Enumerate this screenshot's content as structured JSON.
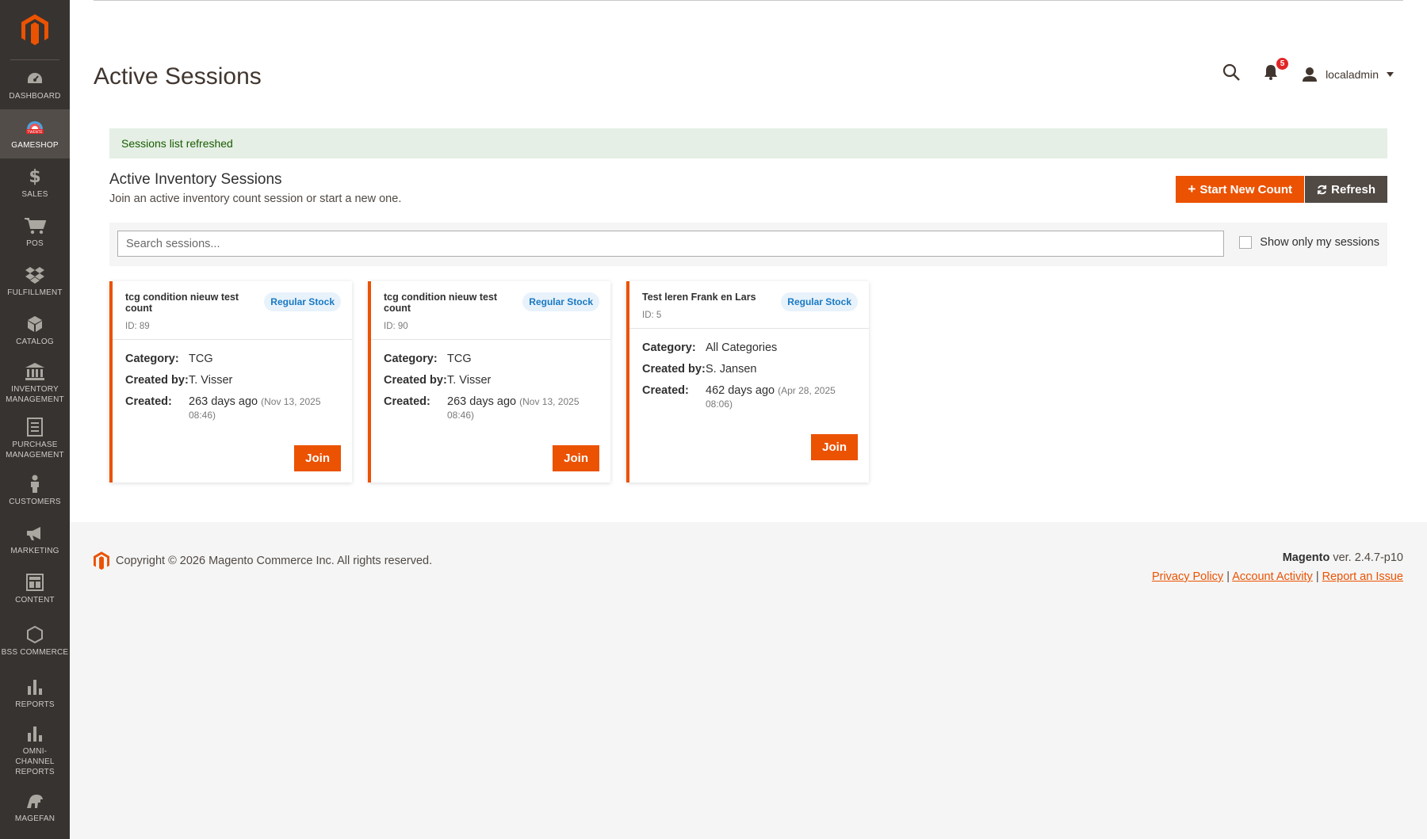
{
  "sidebar": {
    "items": [
      {
        "label": "DASHBOARD",
        "icon": "dashboard-icon"
      },
      {
        "label": "GAMESHOP",
        "icon": "gameshop-icon"
      },
      {
        "label": "SALES",
        "icon": "dollar-icon"
      },
      {
        "label": "POS",
        "icon": "cart-icon"
      },
      {
        "label": "FULFILLMENT",
        "icon": "dropbox-icon"
      },
      {
        "label": "CATALOG",
        "icon": "cube-icon"
      },
      {
        "label": "INVENTORY MANAGEMENT",
        "icon": "bank-icon"
      },
      {
        "label": "PURCHASE MANAGEMENT",
        "icon": "document-icon"
      },
      {
        "label": "CUSTOMERS",
        "icon": "person-icon"
      },
      {
        "label": "MARKETING",
        "icon": "megaphone-icon"
      },
      {
        "label": "CONTENT",
        "icon": "layout-icon"
      },
      {
        "label": "BSS COMMERCE",
        "icon": "hexagon-icon"
      },
      {
        "label": "REPORTS",
        "icon": "bar-chart-icon"
      },
      {
        "label": "OMNI-CHANNEL REPORTS",
        "icon": "bar-chart-icon"
      },
      {
        "label": "MAGEFAN",
        "icon": "magefan-icon"
      }
    ],
    "gameshop_badge": "TWENTE"
  },
  "header": {
    "title": "Active Sessions",
    "notifications_count": "5",
    "username": "localadmin"
  },
  "message": "Sessions list refreshed",
  "section": {
    "title": "Active Inventory Sessions",
    "subtitle": "Join an active inventory count session or start a new one.",
    "start_button": "Start New Count",
    "refresh_button": "Refresh"
  },
  "search": {
    "placeholder": "Search sessions...",
    "filter_label": "Show only my sessions"
  },
  "cards": [
    {
      "name": "tcg condition nieuw test count",
      "id": "ID: 89",
      "tag": "Regular Stock",
      "category_label": "Category:",
      "category": "TCG",
      "created_by_label": "Created by:",
      "created_by": "T. Visser",
      "created_label": "Created:",
      "created_ago": "263 days ago",
      "created_date": "(Nov 13, 2025 08:46)",
      "join": "Join"
    },
    {
      "name": "tcg condition nieuw test count",
      "id": "ID: 90",
      "tag": "Regular Stock",
      "category_label": "Category:",
      "category": "TCG",
      "created_by_label": "Created by:",
      "created_by": "T. Visser",
      "created_label": "Created:",
      "created_ago": "263 days ago",
      "created_date": "(Nov 13, 2025 08:46)",
      "join": "Join"
    },
    {
      "name": "Test leren Frank en Lars",
      "id": "ID: 5",
      "tag": "Regular Stock",
      "category_label": "Category:",
      "category": "All Categories",
      "created_by_label": "Created by:",
      "created_by": "S. Jansen",
      "created_label": "Created:",
      "created_ago": "462 days ago",
      "created_date": "(Apr 28, 2025 08:06)",
      "join": "Join"
    }
  ],
  "footer": {
    "copyright": "Copyright © 2026 Magento Commerce Inc. All rights reserved.",
    "brand": "Magento",
    "version": "ver. 2.4.7-p10",
    "links": [
      "Privacy Policy",
      "Account Activity",
      "Report an Issue"
    ],
    "separator": "|"
  },
  "colors": {
    "accent": "#eb5202",
    "sidebar": "#373330",
    "success_bg": "#e5efe5",
    "success_text": "#185b00",
    "tag_text": "#1979c3"
  }
}
